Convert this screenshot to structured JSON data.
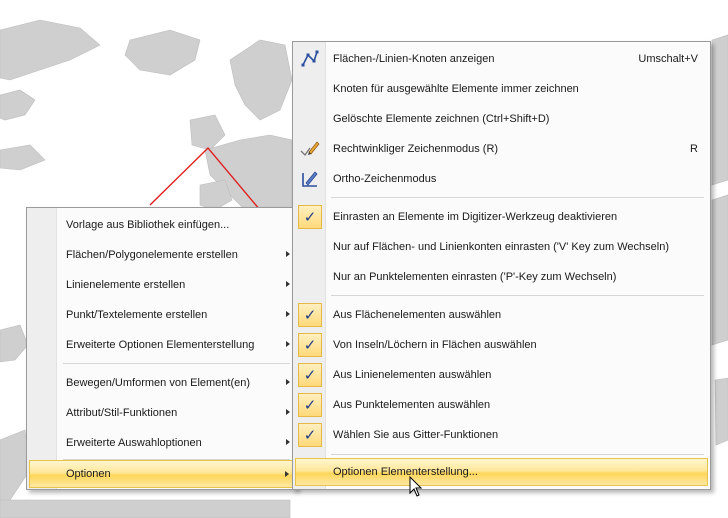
{
  "left_menu": {
    "items": [
      {
        "label": "Vorlage aus Bibliothek einfügen...",
        "submenu": false
      },
      {
        "label": "Flächen/Polygonelemente erstellen",
        "submenu": true
      },
      {
        "label": "Linienelemente erstellen",
        "submenu": true
      },
      {
        "label": "Punkt/Textelemente erstellen",
        "submenu": true
      },
      {
        "label": "Erweiterte Optionen Elementerstellung",
        "submenu": true
      },
      {
        "label": "Bewegen/Umformen von Element(en)",
        "submenu": true
      },
      {
        "label": "Attribut/Stil-Funktionen",
        "submenu": true
      },
      {
        "label": "Erweiterte Auswahloptionen",
        "submenu": true
      },
      {
        "label": "Optionen",
        "submenu": true,
        "highlighted": true
      }
    ]
  },
  "right_menu": {
    "items": [
      {
        "label": "Flächen-/Linien-Knoten anzeigen",
        "shortcut": "Umschalt+V",
        "icon": "nodes-icon"
      },
      {
        "label": "Knoten für ausgewählte Elemente immer zeichnen"
      },
      {
        "label": "Gelöschte Elemente zeichnen (Ctrl+Shift+D)"
      },
      {
        "label": "Rechtwinkliger Zeichenmodus (R)",
        "shortcut": "R",
        "icon": "pencil-check-icon"
      },
      {
        "label": "Ortho-Zeichenmodus",
        "icon": "ortho-draw-icon"
      },
      {
        "label": "Einrasten an Elemente im Digitizer-Werkzeug deaktivieren",
        "checked": true
      },
      {
        "label": "Nur auf Flächen- und Linienkonten einrasten ('V' Key zum Wechseln)"
      },
      {
        "label": "Nur an Punktelementen einrasten ('P'-Key zum Wechseln)"
      },
      {
        "label": "Aus Flächenelementen auswählen",
        "checked": true
      },
      {
        "label": "Von Inseln/Löchern in Flächen auswählen",
        "checked": true
      },
      {
        "label": "Aus Linienelementen auswählen",
        "checked": true
      },
      {
        "label": "Aus Punktelementen auswählen",
        "checked": true
      },
      {
        "label": "Wählen Sie aus Gitter-Funktionen",
        "checked": true
      },
      {
        "label": "Optionen Elementerstellung...",
        "highlighted": true
      }
    ]
  },
  "check_glyph": "✓",
  "colors": {
    "highlight": "#ffd65a",
    "check_bg": "#ffe08a",
    "map_land": "#cfcfcf",
    "map_line": "#e02020"
  }
}
